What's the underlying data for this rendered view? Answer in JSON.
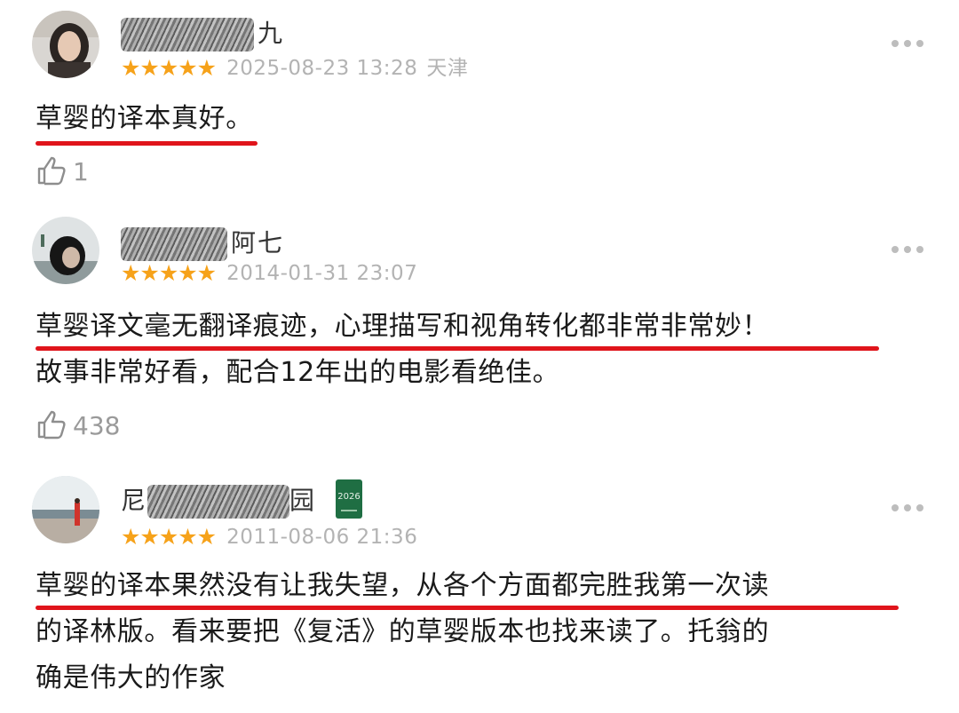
{
  "reviews": [
    {
      "username_visible": "九",
      "stars": "★★★★★",
      "date": "2025-08-23 13:28",
      "location": "天津",
      "lines": [
        "草婴的译本真好。"
      ],
      "likes": "1"
    },
    {
      "username_visible": "阿七",
      "stars": "★★★★★",
      "date": "2014-01-31 23:07",
      "location": "",
      "lines": [
        "草婴译文毫无翻译痕迹，心理描写和视角转化都非常非常妙！",
        "故事非常好看，配合12年出的电影看绝佳。"
      ],
      "likes": "438"
    },
    {
      "username_visible": "尼",
      "username_tail": "园",
      "badge_text": "2026",
      "stars": "★★★★★",
      "date": "2011-08-06 21:36",
      "location": "",
      "lines": [
        "草婴的译本果然没有让我失望，从各个方面都完胜我第一次读",
        "的译林版。看来要把《复活》的草婴版本也找来读了。托翁的",
        "确是伟大的作家"
      ]
    }
  ],
  "colors": {
    "star": "#f6a21a",
    "underline": "#e0141b",
    "meta": "#b3b3b3",
    "badge": "#1f6e43"
  },
  "icons": {
    "more": "more-dots-icon",
    "like": "thumbs-up-icon"
  }
}
